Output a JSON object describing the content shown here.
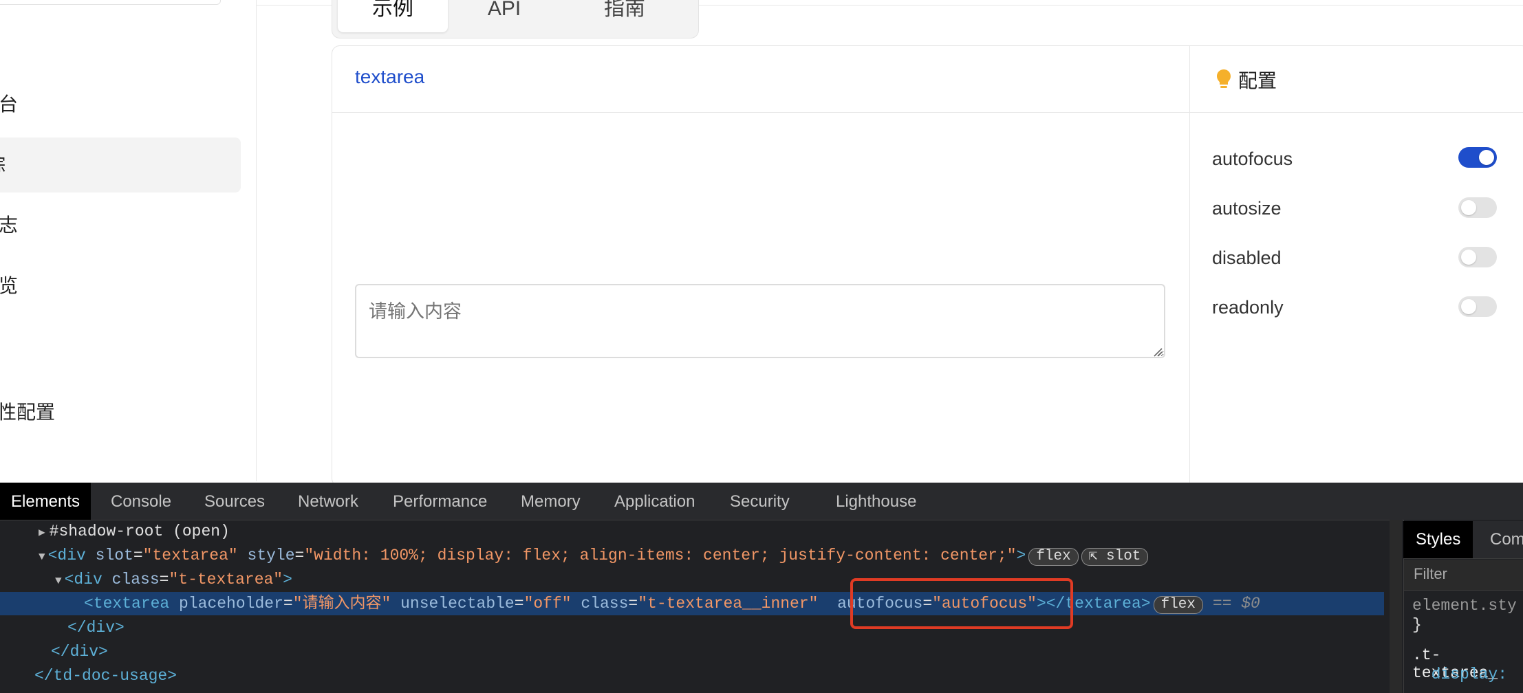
{
  "sidebar": {
    "items": [
      {
        "label": "控制台",
        "active": false
      },
      {
        "label": "链路追踪",
        "active": true
      },
      {
        "label": "日志",
        "active": false
      },
      {
        "label": "总览",
        "active": false
      },
      {
        "label": "属性配置",
        "active": false
      }
    ]
  },
  "tabs": [
    {
      "label": "示例",
      "active": true
    },
    {
      "label": "API",
      "active": false
    },
    {
      "label": "指南",
      "active": false
    }
  ],
  "demo": {
    "title": "textarea",
    "textarea_placeholder": "请输入内容"
  },
  "config": {
    "title": "配置",
    "options": [
      {
        "label": "autofocus",
        "on": true
      },
      {
        "label": "autosize",
        "on": false
      },
      {
        "label": "disabled",
        "on": false
      },
      {
        "label": "readonly",
        "on": false
      }
    ]
  },
  "devtools": {
    "tabs": [
      "Elements",
      "Console",
      "Sources",
      "Network",
      "Performance",
      "Memory",
      "Application",
      "Security",
      "Lighthouse"
    ],
    "active_tab": "Elements",
    "styles_tabs": [
      "Styles",
      "Com"
    ],
    "styles_filter_placeholder": "Filter",
    "styles_lines": [
      "element.sty",
      "}",
      ".t-textarea_",
      "  display:"
    ],
    "tree": {
      "line1": "#shadow-root (open)",
      "line2_tag_open": "<div",
      "line2_attr1": "slot",
      "line2_val1": "\"textarea\"",
      "line2_attr2": "style",
      "line2_val2": "\"width: 100%; display: flex; align-items: center; justify-content: center;\"",
      "line2_close": ">",
      "badge_flex": "flex",
      "badge_slot": "slot",
      "line3_tag": "<div",
      "line3_attr": "class",
      "line3_val": "\"t-textarea\"",
      "line4_tag": "<textarea",
      "line4_attr1": "placeholder",
      "line4_val1": "\"请输入内容\"",
      "line4_attr2": "unselectable",
      "line4_val2": "\"off\"",
      "line4_attr3": "class",
      "line4_val3": "\"t-textarea__inner\"",
      "line4_attr4": "autofocus",
      "line4_val4": "\"autofocus\"",
      "line4_end": "></textarea>",
      "line4_eq": "== $0",
      "line5": "</div>",
      "line6": "</div>",
      "line7": "</td-doc-usage>"
    }
  }
}
